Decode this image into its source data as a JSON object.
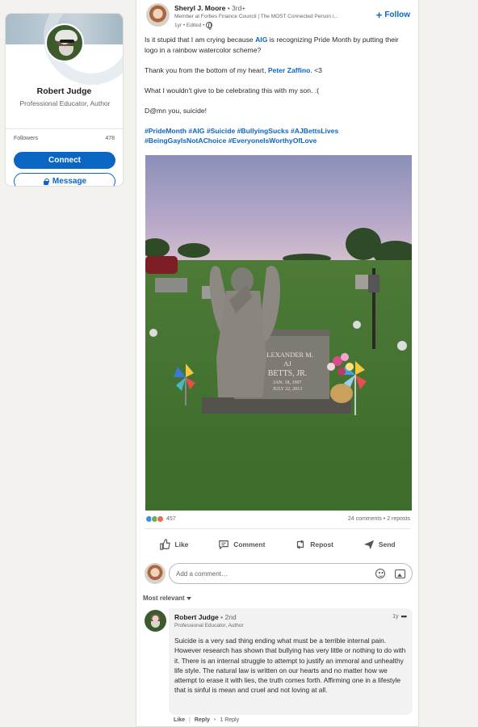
{
  "profile": {
    "name": "Robert Judge",
    "headline": "Professional Educator, Author",
    "followers_label": "Followers",
    "followers_count": "478",
    "connect_label": "Connect",
    "message_label": "Message"
  },
  "post": {
    "author": "Sheryl J. Moore",
    "degree": "• 3rd+",
    "headline": "Member at Forbes Finance Council | The MOST Connected Person i...",
    "meta": "1yr • Edited •",
    "follow_label": "Follow",
    "text": {
      "p1_pre": "Is it stupid that I am crying because ",
      "p1_mention": "AIG",
      "p1_post": " is recognizing Pride Month by putting their logo in a rainbow watercolor scheme?",
      "p2_pre": "Thank you from the bottom of my heart, ",
      "p2_mention": "Peter Zaffino",
      "p2_post": ". <3",
      "p3": "What I wouldn't give to be celebrating this with my son. :(",
      "p4": "D@mn you, suicide!",
      "hashtags_line1": "#PrideMonth #AIG #Suicide #BullyingSucks #AJBettsLives",
      "hashtags_line2": "#BeingGayIsNotAChoice #EveryoneIsWorthyOfLove"
    },
    "image_engraving": [
      "ALEXANDER M.",
      "AJ",
      "BETTS, JR.",
      "JAN. 18, 1997",
      "JULY 22, 2013"
    ],
    "reaction_count": "457",
    "comments_reposts": "24 comments • 2 reposts",
    "actions": [
      "Like",
      "Comment",
      "Repost",
      "Send"
    ],
    "comment_placeholder": "Add a comment…",
    "sort_label": "Most relevant"
  },
  "comment": {
    "author": "Robert Judge",
    "degree": "• 2nd",
    "headline": "Professional Educator, Author",
    "time": "1y",
    "text": "Suicide is a very sad thing ending what must be a terrible internal pain.  However research has shown that bullying has very little or nothing to do with it.  There is an internal struggle to attempt to justify an immoral and unhealthy life style.  The natural law is written on our hearts and no matter how we attempt to erase it with lies, the truth comes forth.  Affirming one in a lifestyle that is sinful is mean and cruel and not loving at all.",
    "like_label": "Like",
    "reply_label": "Reply",
    "reply_count": "1 Reply"
  }
}
